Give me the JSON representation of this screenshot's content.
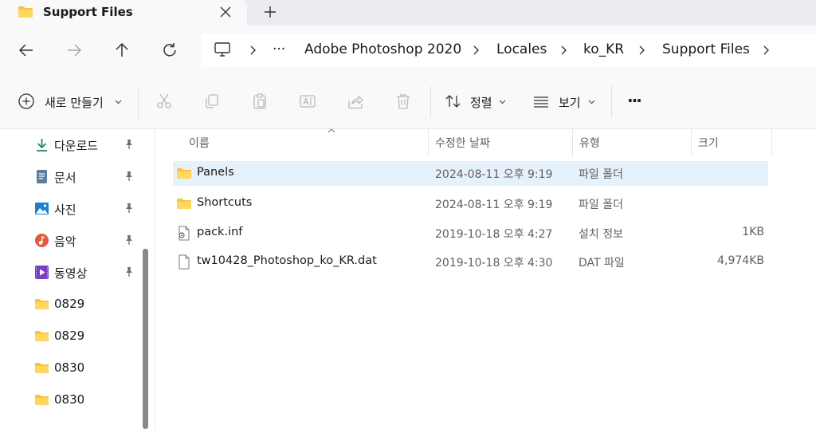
{
  "tab": {
    "title": "Support Files"
  },
  "breadcrumb": {
    "overflow": "···",
    "items": [
      "Adobe Photoshop 2020",
      "Locales",
      "ko_KR",
      "Support Files"
    ]
  },
  "toolbar": {
    "new_label": "새로 만들기",
    "sort_label": "정렬",
    "view_label": "보기",
    "more_label": "···"
  },
  "sidebar": {
    "items": [
      {
        "label": "다운로드",
        "icon": "download-icon",
        "pinned": true
      },
      {
        "label": "문서",
        "icon": "documents-icon",
        "pinned": true
      },
      {
        "label": "사진",
        "icon": "pictures-icon",
        "pinned": true
      },
      {
        "label": "음악",
        "icon": "music-icon",
        "pinned": true
      },
      {
        "label": "동영상",
        "icon": "videos-icon",
        "pinned": true
      },
      {
        "label": "0829",
        "icon": "folder-icon",
        "pinned": false
      },
      {
        "label": "0829",
        "icon": "folder-icon",
        "pinned": false
      },
      {
        "label": "0830",
        "icon": "folder-icon",
        "pinned": false
      },
      {
        "label": "0830",
        "icon": "folder-icon",
        "pinned": false
      }
    ]
  },
  "columns": {
    "name": "이름",
    "date": "수정한 날짜",
    "type": "유형",
    "size": "크기"
  },
  "files": [
    {
      "name": "Panels",
      "date": "2024-08-11 오후 9:19",
      "type": "파일 폴더",
      "size": "",
      "icon": "folder-icon",
      "selected": true
    },
    {
      "name": "Shortcuts",
      "date": "2024-08-11 오후 9:19",
      "type": "파일 폴더",
      "size": "",
      "icon": "folder-icon",
      "selected": false
    },
    {
      "name": "pack.inf",
      "date": "2019-10-18 오후 4:27",
      "type": "설치 정보",
      "size": "1KB",
      "icon": "setup-info-file-icon",
      "selected": false
    },
    {
      "name": "tw10428_Photoshop_ko_KR.dat",
      "date": "2019-10-18 오후 4:30",
      "type": "DAT 파일",
      "size": "4,974KB",
      "icon": "file-icon",
      "selected": false
    }
  ],
  "colors": {
    "folder": "#f5c440",
    "selection": "#e5f1fb",
    "accent": "#0f6cbd"
  }
}
